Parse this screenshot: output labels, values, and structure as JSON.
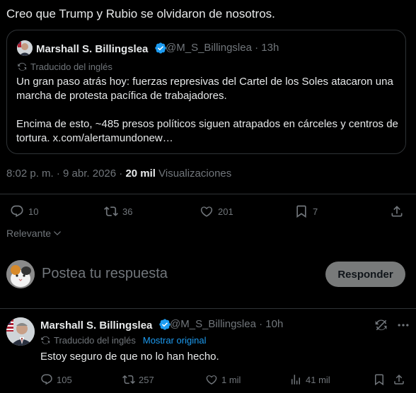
{
  "tweet": {
    "text": "Creo que Trump y Rubio se olvidaron de nosotros."
  },
  "quote": {
    "name": "Marshall S. Billingslea",
    "handle_time": "@M_S_Billingslea · 13h",
    "translated_label": "Traducido del inglés",
    "paragraph1": "Un gran paso atrás hoy: fuerzas represivas del Cartel de los Soles atacaron una marcha de protesta pacífica de trabajadores.",
    "paragraph2": "Encima de esto, ~485 presos políticos siguen atrapados en cárceles y centros de tortura. x.com/alertamundonew…"
  },
  "meta": {
    "time_date": "8:02 p. m. · 9 abr. 2026 · ",
    "views_count": "20 mil",
    "views_label": "Visualizaciones"
  },
  "actions": {
    "replies": "10",
    "reposts": "36",
    "likes": "201",
    "bookmarks": "7"
  },
  "sort": {
    "label": "Relevante"
  },
  "reply_box": {
    "placeholder": "Postea tu respuesta",
    "button_label": "Responder"
  },
  "reply": {
    "name": "Marshall S. Billingslea",
    "handle_time": "@M_S_Billingslea · 10h",
    "translated_label": "Traducido del inglés",
    "show_original": "Mostrar original",
    "text": "Estoy seguro de que no lo han hecho.",
    "replies": "105",
    "reposts": "257",
    "likes": "1 mil",
    "views": "41 mil"
  },
  "colors": {
    "background": "#000000",
    "text": "#e7e9ea",
    "muted": "#71767b",
    "accent": "#1d9bf0",
    "border": "#2f3336"
  }
}
